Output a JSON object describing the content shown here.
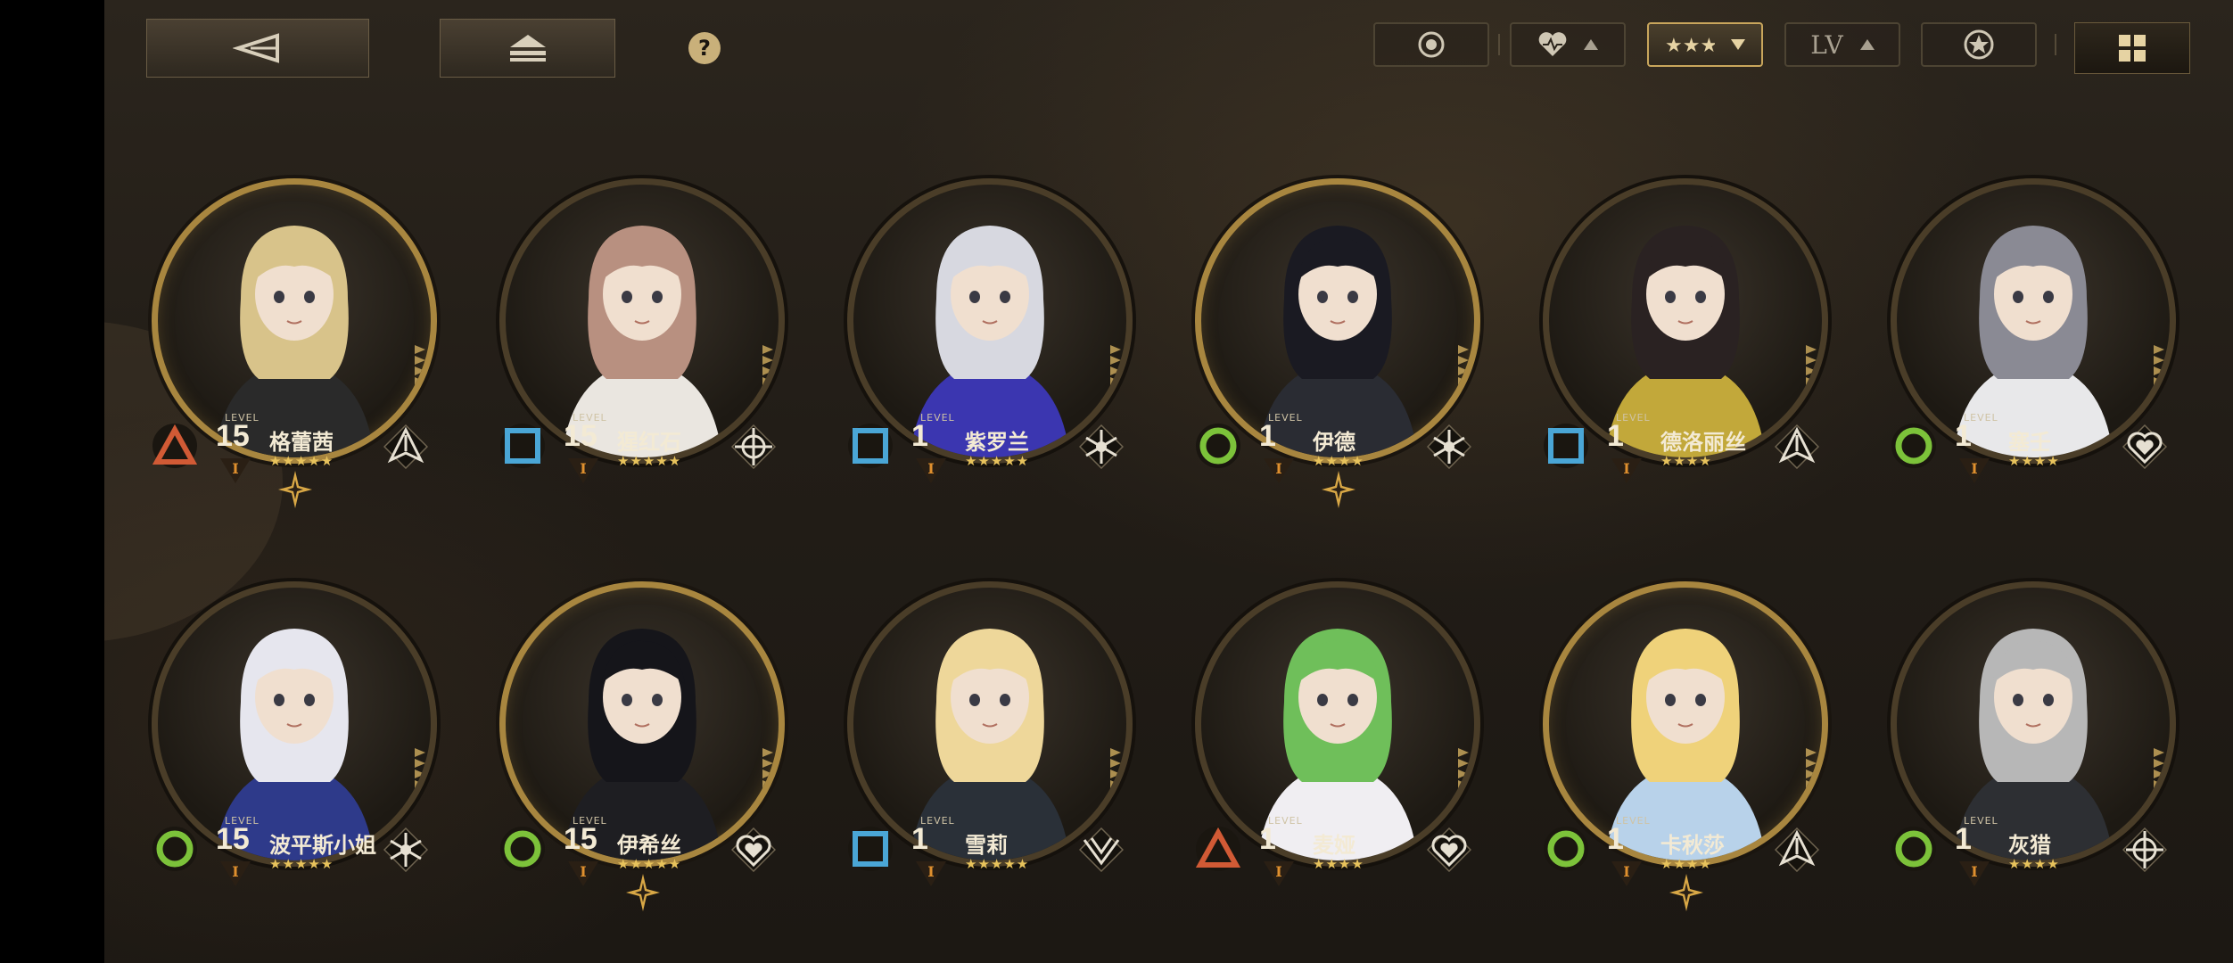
{
  "toolbar": {
    "back_icon": "triangle-left-icon",
    "eject_icon": "eject-icon",
    "help_label": "?",
    "filters": [
      {
        "name": "circle-target-icon"
      },
      {
        "name": "heart-icon",
        "sort": "up"
      },
      {
        "name": "stars-icon",
        "sort": "down",
        "active": true
      },
      {
        "name": "lv",
        "label": "LV",
        "sort": "up"
      },
      {
        "name": "star-badge-icon"
      }
    ],
    "grid_view_icon": "grid-icon"
  },
  "colors": {
    "gold": "#a8863f",
    "accent": "#c9a65c",
    "triangle": "#d15a35",
    "square": "#4aa6d6",
    "circle": "#7cc23a",
    "star": "#e8c35c"
  },
  "characters": [
    {
      "name": "格蕾茜",
      "level_label": "LEVEL",
      "level": "15",
      "rank": "I",
      "stars": "★★★★★",
      "type": "triangle",
      "role": "spike-role-icon",
      "highlight": true,
      "hair": "#d8c38a",
      "outfit": "#2a2a2a"
    },
    {
      "name": "猩红石",
      "level_label": "LEVEL",
      "level": "15",
      "rank": "I",
      "stars": "★★★★★",
      "type": "square",
      "role": "crosshair-role-icon",
      "highlight": false,
      "hair": "#b89080",
      "outfit": "#eae6e0"
    },
    {
      "name": "紫罗兰",
      "level_label": "LEVEL",
      "level": "1",
      "rank": "I",
      "stars": "★★★★★",
      "type": "square",
      "role": "snowflake-role-icon",
      "highlight": false,
      "hair": "#d7d8e0",
      "outfit": "#3b36b0"
    },
    {
      "name": "伊德",
      "level_label": "LEVEL",
      "level": "1",
      "rank": "I",
      "stars": "★★★★",
      "type": "circle",
      "role": "snowflake-role-icon",
      "highlight": true,
      "hair": "#1a1a22",
      "outfit": "#2a2c33"
    },
    {
      "name": "德洛丽丝",
      "level_label": "LEVEL",
      "level": "1",
      "rank": "I",
      "stars": "★★★★",
      "type": "square",
      "role": "spike-role-icon",
      "highlight": false,
      "hair": "#2a2222",
      "outfit": "#c2a83a"
    },
    {
      "name": "塞壬",
      "level_label": "LEVEL",
      "level": "1",
      "rank": "I",
      "stars": "★★★★",
      "type": "circle",
      "role": "heart-role-icon",
      "highlight": false,
      "hair": "#8a8a94",
      "outfit": "#e8e8ea"
    },
    {
      "name": "波平斯小姐",
      "level_label": "LEVEL",
      "level": "15",
      "rank": "I",
      "stars": "★★★★★",
      "type": "circle",
      "role": "snowflake-role-icon",
      "highlight": false,
      "hair": "#e6e6ee",
      "outfit": "#2e3a8a"
    },
    {
      "name": "伊希丝",
      "level_label": "LEVEL",
      "level": "15",
      "rank": "I",
      "stars": "★★★★★",
      "type": "circle",
      "role": "heart-role-icon",
      "highlight": true,
      "hair": "#15151a",
      "outfit": "#1e1e22"
    },
    {
      "name": "雪莉",
      "level_label": "LEVEL",
      "level": "1",
      "rank": "I",
      "stars": "★★★★★",
      "type": "square",
      "role": "wing-role-icon",
      "highlight": false,
      "hair": "#eed79a",
      "outfit": "#2a3038"
    },
    {
      "name": "麦娅",
      "level_label": "LEVEL",
      "level": "1",
      "rank": "I",
      "stars": "★★★★",
      "type": "triangle",
      "role": "heart-role-icon",
      "highlight": false,
      "hair": "#6fbf5a",
      "outfit": "#f0eef2"
    },
    {
      "name": "卡秋莎",
      "level_label": "LEVEL",
      "level": "1",
      "rank": "I",
      "stars": "★★★★",
      "type": "circle",
      "role": "spike-role-icon",
      "highlight": true,
      "hair": "#efd27a",
      "outfit": "#b8d2ea"
    },
    {
      "name": "灰猎",
      "level_label": "LEVEL",
      "level": "1",
      "rank": "I",
      "stars": "★★★★",
      "type": "circle",
      "role": "crosshair-role-icon",
      "highlight": false,
      "hair": "#b7b7b7",
      "outfit": "#2d2f33"
    }
  ]
}
